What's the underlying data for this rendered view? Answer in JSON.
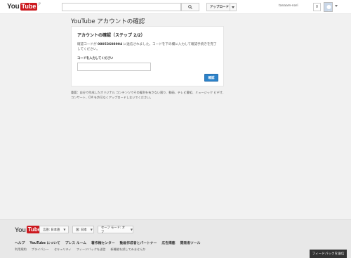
{
  "header": {
    "logo_you": "You",
    "logo_tube": "Tube",
    "logo_sup": "JP",
    "search_placeholder": "",
    "upload_label": "アップロード",
    "username": "tanaam-nari",
    "notifications": "0"
  },
  "page": {
    "title": "YouTube アカウントの確認"
  },
  "card": {
    "heading": "アカウントの確認（ステップ 2/2）",
    "message_prefix": "確認コードが ",
    "phone": "08053608904",
    "message_suffix": " に送信されました。コードを下の欄に入力して確認手続きを完了してください。",
    "code_label": "コードを入力してください",
    "code_value": "",
    "confirm_label": "確認"
  },
  "note": "重要：自分で作成したオリジナル コンテンツでその権利を有さない限り、動画、テレビ番組、ミュージック ビデオ、コンサート、CM を許可なくアップロードしないでください。",
  "footer": {
    "language": "言語: 日本語",
    "country": "国: 日本",
    "safety": "セーフ モード: オフ",
    "links": [
      "ヘルプ",
      "YouTube について",
      "プレス ルーム",
      "著作権センター",
      "動画作成者とパートナー",
      "広告掲載",
      "開発者ツール"
    ],
    "links2": [
      "利用規約",
      "プライバシー",
      "セキュリティ",
      "フィードバックを送信",
      "新機能を試してみませんか"
    ],
    "feedback_label": "フィードバックを送信"
  }
}
